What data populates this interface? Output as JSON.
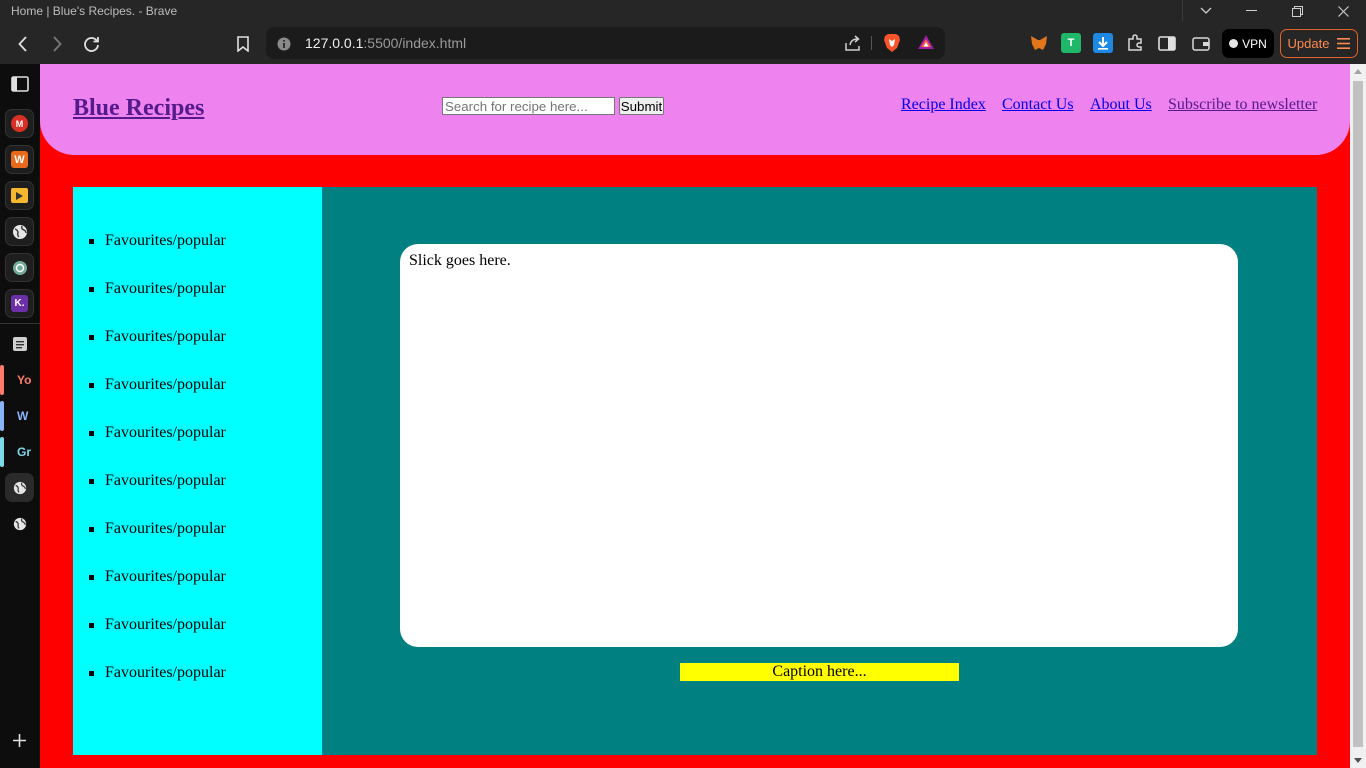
{
  "window": {
    "title": "Home | Blue's Recipes. - Brave",
    "controls": [
      "chevron-down",
      "minimize",
      "restore",
      "close"
    ]
  },
  "toolbar": {
    "url_host": "127.0.0.1",
    "url_path": ":5500/index.html",
    "vpn_label": "VPN",
    "update_label": "Update"
  },
  "sidepanel": {
    "apps": [
      "Gmail",
      "Office",
      "Media",
      "Web",
      "ChatGPT",
      "Klaviyo"
    ],
    "tabs": [
      {
        "label": "Yo",
        "color": "#ff7a6b"
      },
      {
        "label": "W",
        "color": "#8ab4f8"
      },
      {
        "label": "Gr",
        "color": "#7fd8e8"
      }
    ]
  },
  "page": {
    "brand": "Blue Recipes",
    "search": {
      "placeholder": "Search for recipe here...",
      "submit": "Submit"
    },
    "nav": [
      "Recipe Index",
      "Contact Us",
      "About Us",
      "Subscribe to newsletter"
    ],
    "favourites": [
      "Favourites/popular",
      "Favourites/popular",
      "Favourites/popular",
      "Favourites/popular",
      "Favourites/popular",
      "Favourites/popular",
      "Favourites/popular",
      "Favourites/popular",
      "Favourites/popular",
      "Favourites/popular"
    ],
    "slider_text": "Slick goes here.",
    "caption": "Caption here..."
  },
  "colors": {
    "page_bg": "#ff0000",
    "header_bg": "#ee82ee",
    "content_bg": "#008080",
    "sidebar_bg": "#00ffff",
    "caption_bg": "#ffff00",
    "link": "#0000ee",
    "visited_link": "#551a8b"
  }
}
